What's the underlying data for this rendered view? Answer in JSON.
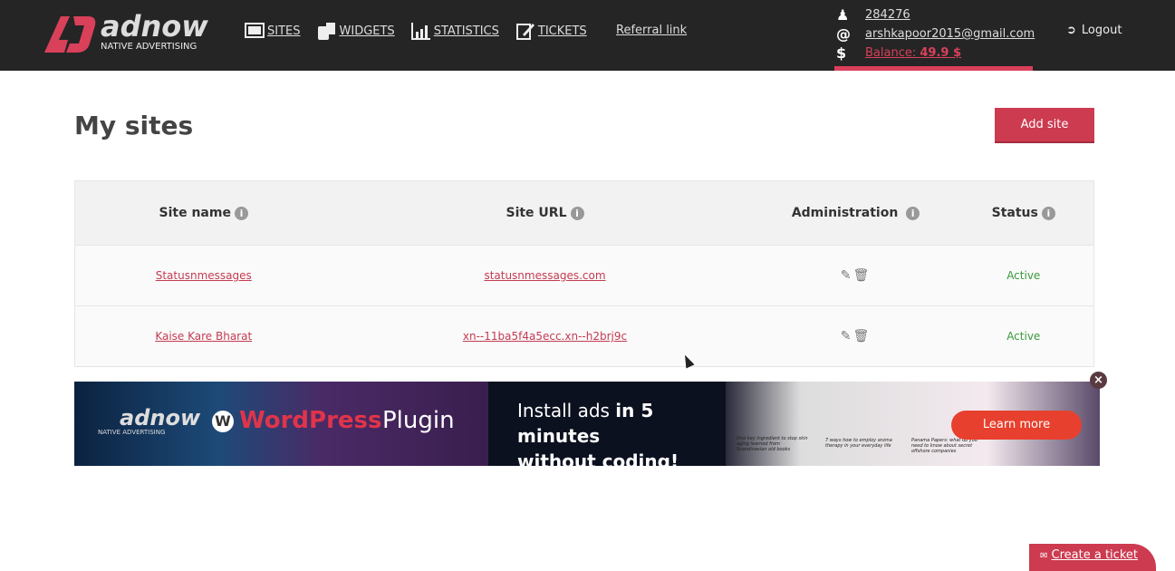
{
  "header": {
    "logo_text": "adnow",
    "logo_sub": "NATIVE ADVERTISING",
    "nav": [
      {
        "label": "SITES",
        "icon": "sites-icon"
      },
      {
        "label": "WIDGETS",
        "icon": "widgets-icon"
      },
      {
        "label": "STATISTICS",
        "icon": "statistics-icon"
      },
      {
        "label": "TICKETS",
        "icon": "tickets-icon"
      }
    ],
    "referral": "Referral link",
    "user_id": "284276",
    "email": "arshkapoor2015@gmail.com",
    "balance_label": "Balance:",
    "balance_value": "49.9 $",
    "logout": "Logout"
  },
  "page": {
    "title": "My sites",
    "add_button": "Add site"
  },
  "table": {
    "columns": [
      "Site name",
      "Site URL",
      "Administration",
      "Status"
    ],
    "rows": [
      {
        "name": "Statusnmessages",
        "url": "statusnmessages.com",
        "status": "Active"
      },
      {
        "name": "Kaise Kare Bharat",
        "url": "xn--11ba5f4a5ecc.xn--h2brj9c",
        "status": "Active"
      }
    ]
  },
  "banner": {
    "wp": "WordPress",
    "plugin": "Plugin",
    "line1a": "Install ads ",
    "line1b": "in 5 minutes",
    "line2": "without coding!",
    "cta": "Learn more",
    "logo_text": "adnow",
    "logo_sub": "NATIVE ADVERTISING",
    "cards": [
      "One key ingredient to stop skin aging learned from Scandinavian old books",
      "7 ways how to employ aroma therapy in your everyday life",
      "Panama Papers: what do you need to know about secret offshore companies"
    ]
  },
  "footer": {
    "ticket": "Create a ticket"
  },
  "colors": {
    "accent": "#cc3b50",
    "header": "#252525",
    "active": "#3a9a3a"
  }
}
